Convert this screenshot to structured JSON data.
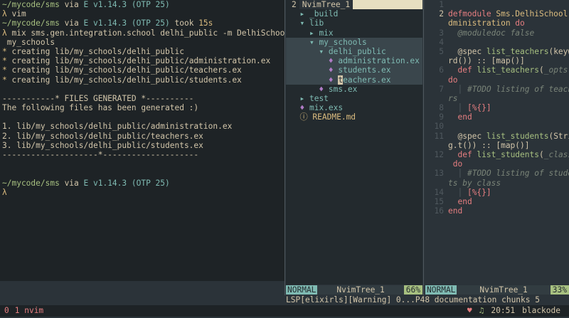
{
  "terminal": {
    "lines": [
      {
        "path": "~/mycode/sms",
        "via": " via ",
        "ver": "E v1.14.3 (OTP 25)",
        "tail": ""
      },
      {
        "lambda": "λ",
        "cmd": " vim"
      },
      {
        "path": "~/mycode/sms",
        "via": " via ",
        "ver": "E v1.14.3 (OTP 25)",
        "took": " took ",
        "took_val": "15s"
      },
      {
        "lambda": "λ",
        "cmd": " mix sms.gen.integration.school delhi_public -m DelhiSchool -p"
      },
      {
        "plain": " my_schools"
      },
      {
        "star": "*",
        "cmd": " creating lib/my_schools/delhi_public"
      },
      {
        "star": "*",
        "cmd": " creating lib/my_schools/delhi_public/administration.ex"
      },
      {
        "star": "*",
        "cmd": " creating lib/my_schools/delhi_public/teachers.ex"
      },
      {
        "star": "*",
        "cmd": " creating lib/my_schools/delhi_public/students.ex"
      },
      {
        "plain": ""
      },
      {
        "plain": "-----------* FILES GENERATED *----------"
      },
      {
        "plain": "The following files has been generated :)"
      },
      {
        "plain": ""
      },
      {
        "plain": "1. lib/my_schools/delhi_public/administration.ex"
      },
      {
        "plain": "2. lib/my_schools/delhi_public/teachers.ex"
      },
      {
        "plain": "3. lib/my_schools/delhi_public/students.ex"
      },
      {
        "plain": "--------------------*--------------------"
      },
      {
        "plain": ""
      },
      {
        "plain": ""
      },
      {
        "path": "~/mycode/sms",
        "via": " via ",
        "ver": "E v1.14.3 (OTP 25)",
        "tail": ""
      },
      {
        "lambda": "λ",
        "cmd": ""
      }
    ]
  },
  "tree": {
    "tab_number": "2",
    "tab_name": "NvimTree_1",
    "rows": [
      {
        "indent": "  ",
        "icon": "▸ ",
        "name": "_build",
        "kind": "folder"
      },
      {
        "indent": "  ",
        "icon": "▾ ",
        "name": "lib",
        "kind": "folder"
      },
      {
        "indent": "    ",
        "icon": "▸ ",
        "name": "mix",
        "kind": "folder"
      },
      {
        "indent": "    ",
        "icon": "▾ ",
        "name": "my_schools",
        "kind": "folder",
        "sel": true
      },
      {
        "indent": "      ",
        "icon": "▾ ",
        "name": "delhi_public",
        "kind": "folder",
        "sel": true
      },
      {
        "indent": "        ",
        "icon": "💧",
        "name": "administration.ex",
        "kind": "file",
        "sel": true
      },
      {
        "indent": "        ",
        "icon": "💧",
        "name": "students.ex",
        "kind": "file",
        "sel": true
      },
      {
        "indent": "        ",
        "icon": "💧",
        "name": "teachers.ex",
        "kind": "file",
        "sel": true,
        "cursor": true
      },
      {
        "indent": "      ",
        "icon": "💧",
        "name": "sms.ex",
        "kind": "file"
      },
      {
        "indent": "  ",
        "icon": "▸ ",
        "name": "test",
        "kind": "folder"
      },
      {
        "indent": "  ",
        "icon": "💧",
        "name": "mix.exs",
        "kind": "file"
      },
      {
        "indent": "  ",
        "icon": "ⓘ ",
        "name": "README.md",
        "kind": "readme"
      }
    ]
  },
  "code": {
    "rows": [
      {
        "n": "1",
        "html": ""
      },
      {
        "n": "2",
        "cur": true,
        "parts": [
          [
            "kw",
            "defmodule "
          ],
          [
            "mod",
            "Sms.DelhiSchool.A"
          ]
        ]
      },
      {
        "n": "",
        "parts": [
          [
            "mod",
            "dministration "
          ],
          [
            "kw",
            "do"
          ]
        ]
      },
      {
        "n": "3",
        "parts": [
          [
            "gd",
            "  "
          ],
          [
            "cm",
            "@moduledoc false"
          ]
        ]
      },
      {
        "n": "4",
        "parts": []
      },
      {
        "n": "5",
        "parts": [
          [
            "pu",
            "  @spec "
          ],
          [
            "fn",
            "list_teachers"
          ],
          [
            "pu",
            "(keywo"
          ]
        ]
      },
      {
        "n": "",
        "parts": [
          [
            "pu",
            "rd()) :: [map()]"
          ]
        ]
      },
      {
        "n": "6",
        "parts": [
          [
            "kw",
            "  def "
          ],
          [
            "fn",
            "list_teachers"
          ],
          [
            "pu",
            "("
          ],
          [
            "cm",
            "_opts"
          ],
          [
            "pu",
            ")"
          ]
        ]
      },
      {
        "n": "",
        "parts": [
          [
            "kw",
            "do"
          ]
        ]
      },
      {
        "n": "7",
        "parts": [
          [
            "gd",
            "  │ "
          ],
          [
            "cm",
            "#TODO listing of teache"
          ]
        ]
      },
      {
        "n": "",
        "parts": [
          [
            "cm",
            "rs"
          ]
        ]
      },
      {
        "n": "8",
        "parts": [
          [
            "gd",
            "  │ "
          ],
          [
            "kw",
            "[%{}]"
          ]
        ]
      },
      {
        "n": "9",
        "parts": [
          [
            "kw",
            "  end"
          ]
        ]
      },
      {
        "n": "10",
        "parts": []
      },
      {
        "n": "11",
        "parts": [
          [
            "pu",
            "  @spec "
          ],
          [
            "fn",
            "list_students"
          ],
          [
            "pu",
            "(Strin"
          ]
        ]
      },
      {
        "n": "",
        "parts": [
          [
            "pu",
            "g.t()) :: [map()]"
          ]
        ]
      },
      {
        "n": "12",
        "parts": [
          [
            "kw",
            "  def "
          ],
          [
            "fn",
            "list_students"
          ],
          [
            "pu",
            "("
          ],
          [
            "cm",
            "_class"
          ],
          [
            "pu",
            ")"
          ]
        ]
      },
      {
        "n": "",
        "parts": [
          [
            "kw",
            " do"
          ]
        ]
      },
      {
        "n": "13",
        "parts": [
          [
            "gd",
            "  │ "
          ],
          [
            "cm",
            "#TODO listing of studen"
          ]
        ]
      },
      {
        "n": "",
        "parts": [
          [
            "cm",
            "ts by class"
          ]
        ]
      },
      {
        "n": "14",
        "parts": [
          [
            "gd",
            "  │ "
          ],
          [
            "kw",
            "[%{}]"
          ]
        ]
      },
      {
        "n": "15",
        "parts": [
          [
            "kw",
            "  end"
          ]
        ]
      },
      {
        "n": "16",
        "parts": [
          [
            "kw",
            "end"
          ]
        ]
      }
    ]
  },
  "status_tree": {
    "mode": "NORMAL",
    "file": "NvimTree_1",
    "pct": "66%"
  },
  "status_code": {
    "mode": "NORMAL",
    "file": "NvimTree_1",
    "pct": "33%"
  },
  "message": "LSP[elixirls][Warning] 0...P48 documentation chunks 5",
  "tmux": {
    "session": "0",
    "window": "1 nvim",
    "time": "20:51",
    "host": "blackode"
  }
}
